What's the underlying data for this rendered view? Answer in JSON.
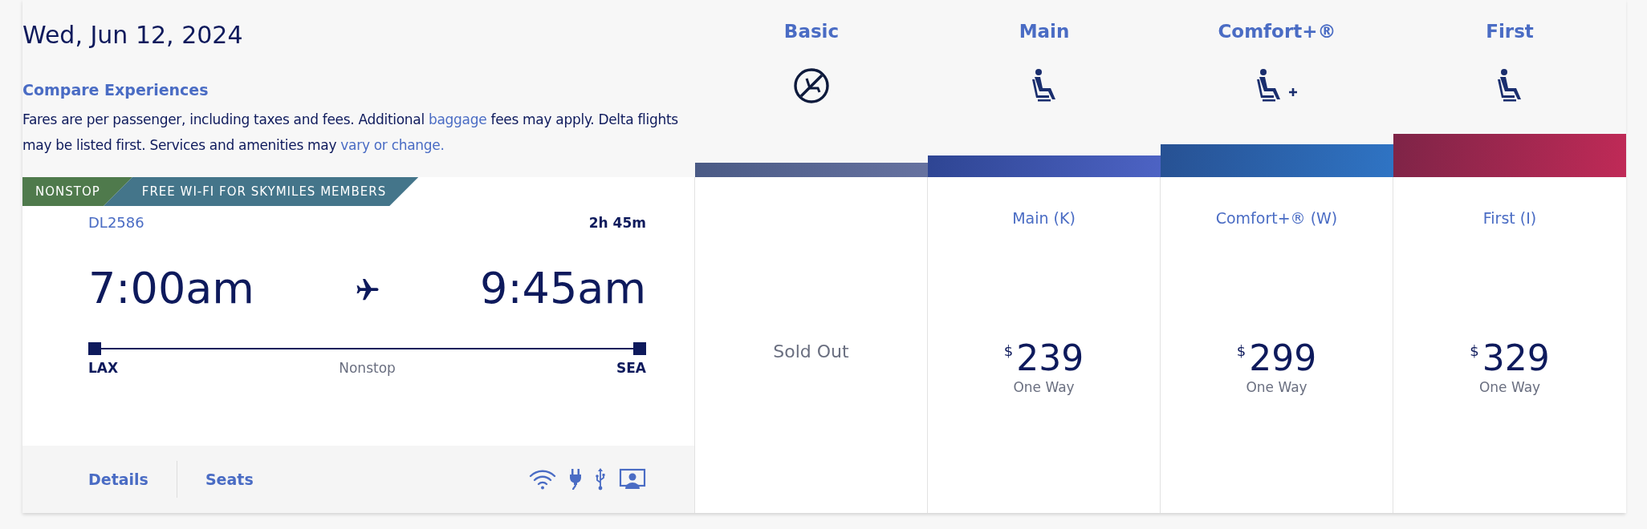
{
  "date": "Wed, Jun 12, 2024",
  "compare": {
    "title": "Compare Experiences",
    "parts": [
      {
        "text": "Fares are per passenger, including taxes and fees. Additional ",
        "link": false
      },
      {
        "text": "baggage",
        "link": true
      },
      {
        "text": " fees may apply. Delta flights may be listed first. Services and amenities may ",
        "link": false
      },
      {
        "text": "vary or change.",
        "link": true
      }
    ]
  },
  "flight": {
    "badges": [
      {
        "text": "NONSTOP",
        "color": "#4f7a4c"
      },
      {
        "text": "FREE WI-FI FOR SKYMILES MEMBERS",
        "color": "#44758a"
      }
    ],
    "number": "DL2586",
    "duration": "2h 45m",
    "depart": "7:00am",
    "arrive": "9:45am",
    "origin": "LAX",
    "destination": "SEA",
    "stops": "Nonstop",
    "links": [
      "Details",
      "Seats"
    ]
  },
  "cabins": [
    {
      "name": "Basic",
      "kind": "no-seat",
      "color": "#4a5a85",
      "fare": {
        "kind": "sold_out",
        "text": "Sold Out"
      }
    },
    {
      "name": "Main",
      "kind": "seat",
      "color": "#2e4593",
      "fare": {
        "kind": "price",
        "label": "Main (K)",
        "currency": "$",
        "amount": "239",
        "note": "One Way"
      }
    },
    {
      "name": "Comfort+®",
      "kind": "seat-plus",
      "color": "#275193",
      "fare": {
        "kind": "price",
        "label": "Comfort+® (W)",
        "currency": "$",
        "amount": "299",
        "note": "One Way"
      }
    },
    {
      "name": "First",
      "kind": "seat",
      "color": "#7e2447",
      "fare": {
        "kind": "price",
        "label": "First (I)",
        "currency": "$",
        "amount": "329",
        "note": "One Way"
      }
    }
  ]
}
